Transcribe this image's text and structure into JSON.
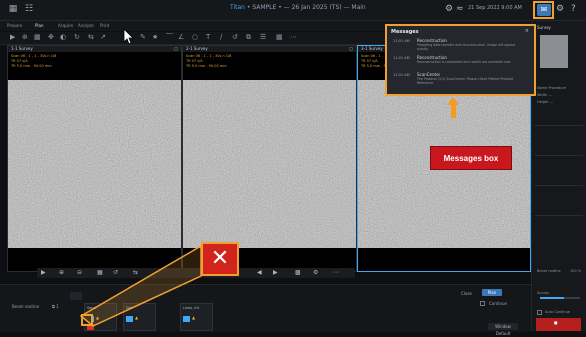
{
  "topbar": {
    "title_main": "Titan",
    "title_sub": "• SAMPLE • — 26 Jan 2025 (TS) — Main",
    "datetime": "21 Sep 2022 9:00 AM",
    "icons": [
      "app-icon",
      "grid-icon",
      "settings-icon",
      "network-icon",
      "messages-icon",
      "gear-icon",
      "help-icon"
    ]
  },
  "tabs": [
    {
      "label": "Prepare",
      "active": false
    },
    {
      "label": "Plan",
      "active": true
    },
    {
      "label": "Acquire",
      "active": false
    },
    {
      "label": "Analyze",
      "active": false
    },
    {
      "label": "Print",
      "active": false
    }
  ],
  "viewports": [
    {
      "label": "1-1 Survey",
      "info": "Scan 06 - 1 - 1 - 30s n 1/8\nTR 07 s/A\nTR 5.0 mm - 90.00 mm"
    },
    {
      "label": "2-1 Survey",
      "info": "Scan 06 - 1 - 1 - 30s n 1/8\nTR 07 s/A\nTR 5.0 mm - 90.00 mm"
    },
    {
      "label": "3-1 Survey",
      "info": "Scan 06 - 1 - 1 - 30s n 1/8\nTR 07 s/A\nTR 5.0 mm - 90.00 mm"
    }
  ],
  "messages": {
    "header": "Messages",
    "close": "×",
    "items": [
      {
        "time": "11:01 AM",
        "name": "Reconstruction",
        "desc": "Preparing data transfer and reconstruction. Image will appear shortly."
      },
      {
        "time": "11:01 AM",
        "name": "Reconstruction",
        "desc": "Reconstruction is completed and results are available now."
      },
      {
        "time": "11:01 AM",
        "name": "ScanCenter",
        "desc": "The Protocol (1/1) ScanCenter. Please check Patient Protocol Reference"
      }
    ]
  },
  "callout": {
    "label": "Messages box"
  },
  "xmark": "✕",
  "rightpanel": {
    "title": "Survey",
    "rows": [
      "Name  Procedure",
      "Width  —",
      "Height  —"
    ],
    "beam_label": "Beam routine",
    "beam_value": "100 %",
    "survey_label": "Survey",
    "auto_continue": "Auto Continue",
    "slider_value": 0.6
  },
  "bottom": {
    "label": "Beam routine",
    "continue_label": "Continue",
    "window_label": "Window Default",
    "close_label": "Close",
    "plan_label": "Plan",
    "presets": [
      {
        "label": "Sensi"
      },
      {
        "label": "Dist"
      },
      {
        "label": "Lines, Int"
      }
    ]
  },
  "colors": {
    "accent": "#3fa9f5",
    "highlight": "#f0a030",
    "alert": "#c8181e"
  }
}
